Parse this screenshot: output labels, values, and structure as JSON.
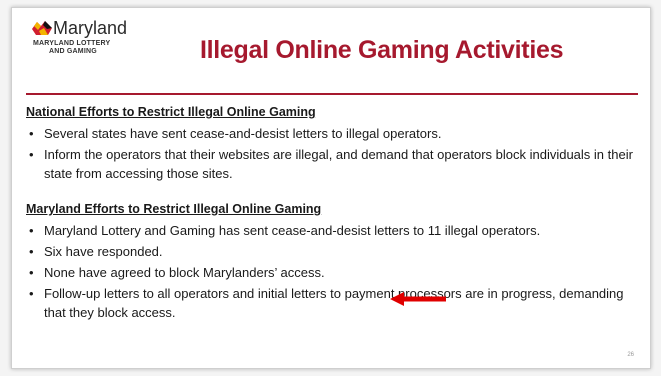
{
  "logo": {
    "name": "Maryland",
    "sub_line1": "MARYLAND LOTTERY",
    "sub_line2": "AND GAMING"
  },
  "slide": {
    "title": "Illegal Online Gaming Activities",
    "page_number": "26",
    "accent_color": "#a6192e",
    "arrow_color": "#e00000"
  },
  "sections": [
    {
      "heading": "National Efforts to Restrict Illegal Online Gaming",
      "bullets": [
        "Several states have sent cease-and-desist letters to illegal operators.",
        "Inform the operators that their websites are illegal, and demand that operators block individuals in their state from accessing those sites."
      ]
    },
    {
      "heading": "Maryland Efforts to Restrict Illegal Online Gaming",
      "bullets": [
        "Maryland Lottery and Gaming has sent cease-and-desist letters to 11 illegal operators.",
        "Six have responded.",
        "None have agreed to block Marylanders’ access.",
        "Follow-up letters to all operators and initial letters to payment processors are in progress, demanding that they block access."
      ]
    }
  ]
}
